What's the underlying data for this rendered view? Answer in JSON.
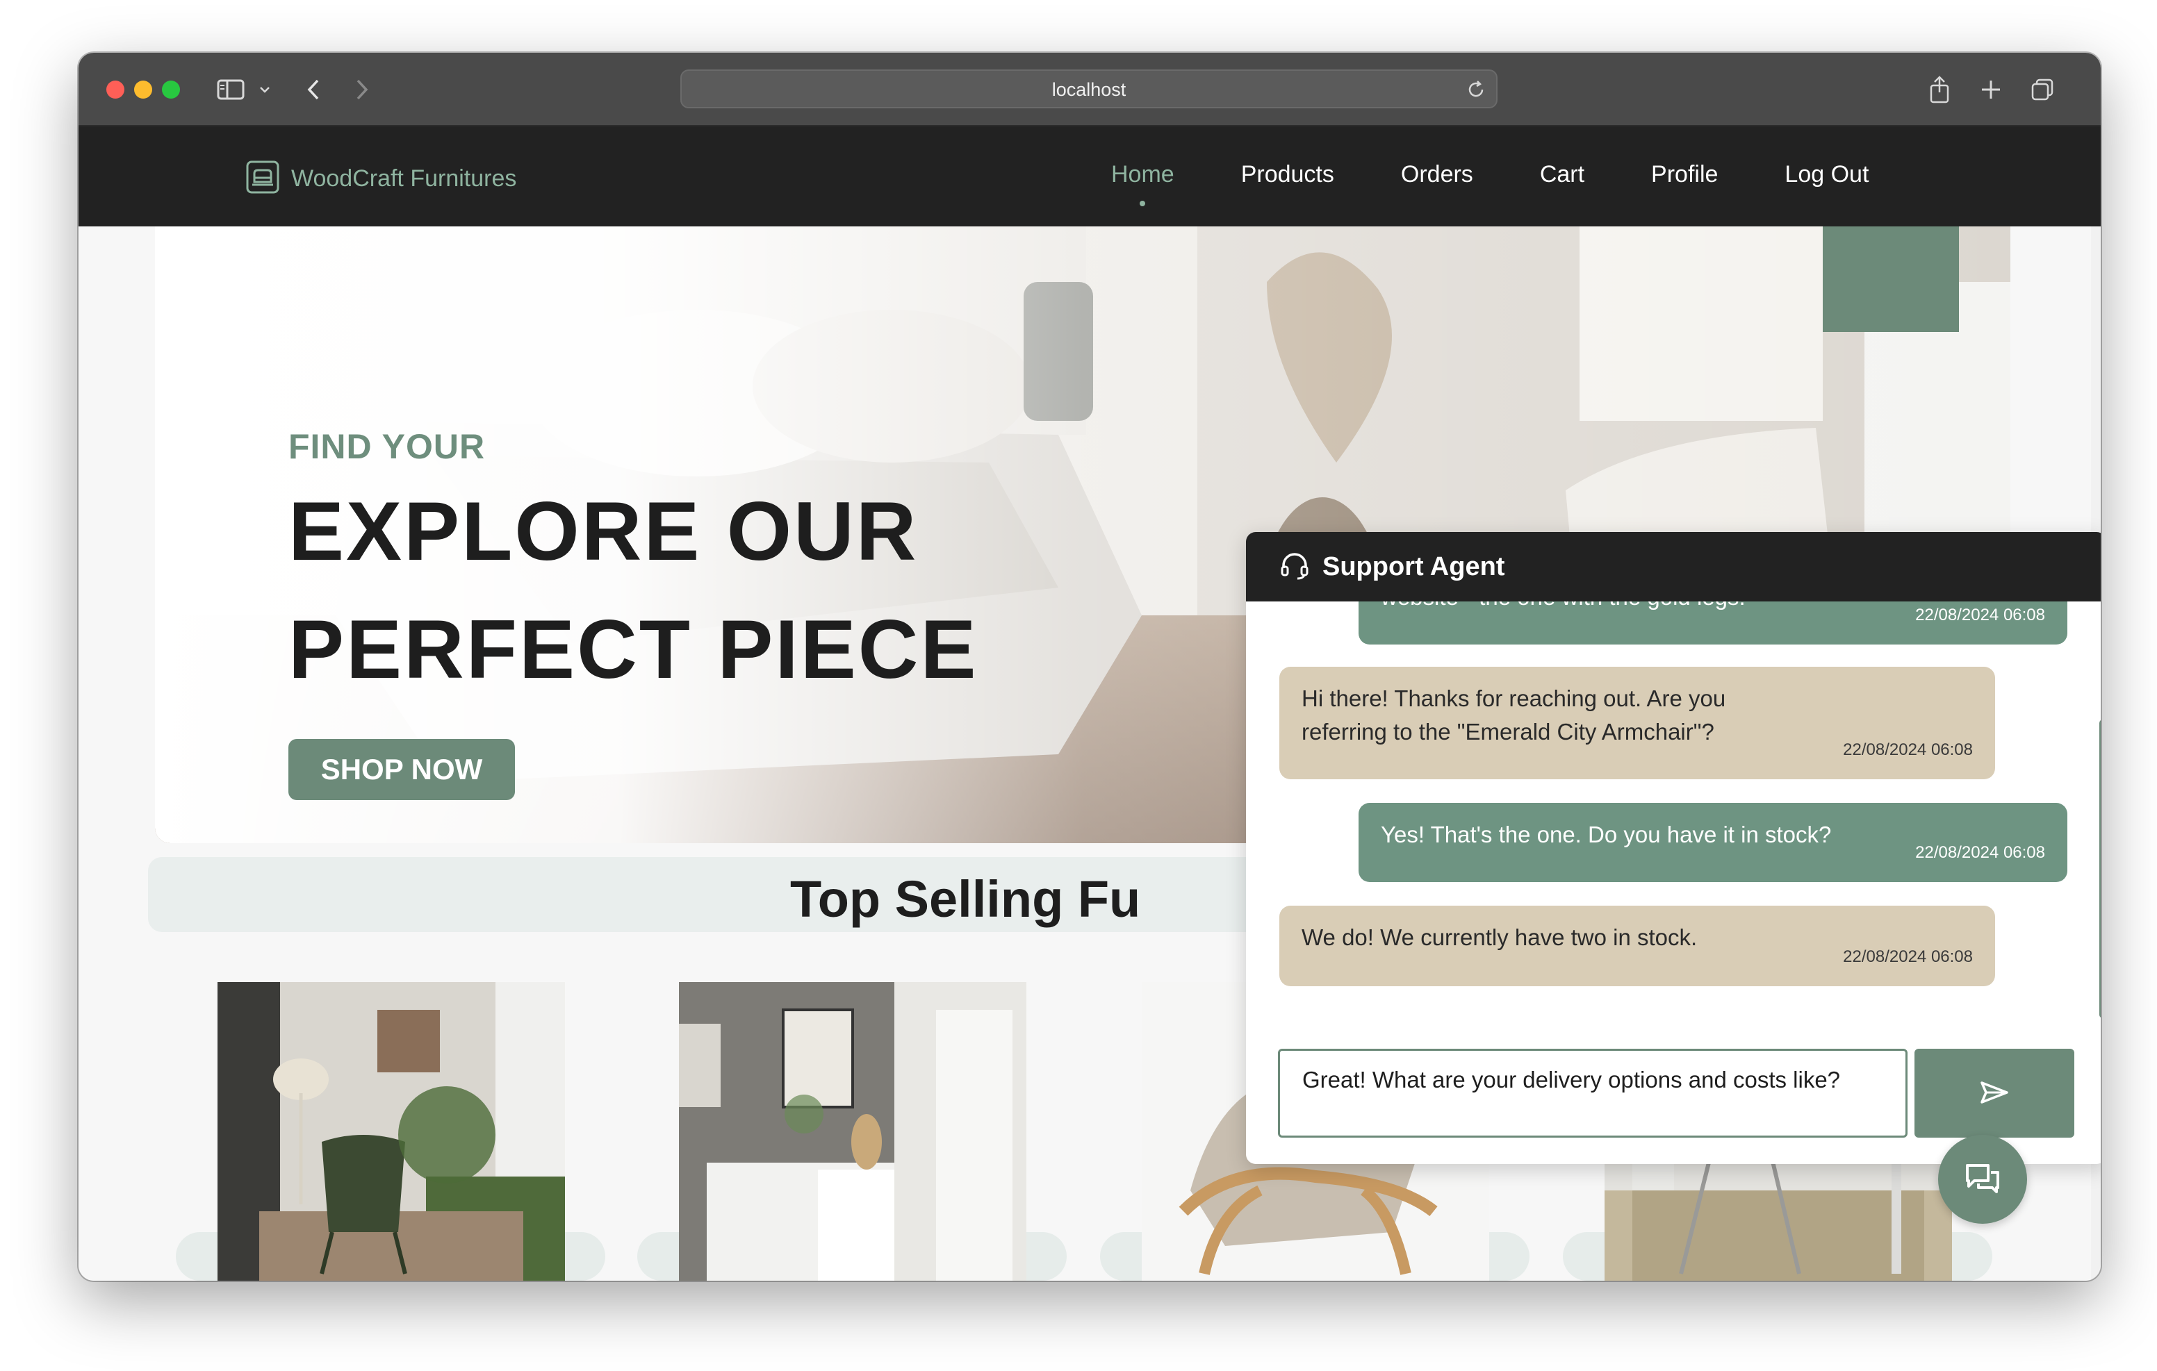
{
  "browser": {
    "url": "localhost"
  },
  "nav": {
    "brand": "WoodCraft Furnitures",
    "links": [
      "Home",
      "Products",
      "Orders",
      "Cart",
      "Profile",
      "Log Out"
    ],
    "active": "Home"
  },
  "hero": {
    "eyebrow": "FIND YOUR",
    "headline_line1": "EXPLORE OUR",
    "headline_line2": "PERFECT PIECE",
    "cta": "SHOP NOW"
  },
  "section": {
    "title": "Top Selling Fu"
  },
  "chat": {
    "title": "Support Agent",
    "messages": [
      {
        "role": "user",
        "text": "website - the one with the gold legs.",
        "time": "22/08/2024 06:08"
      },
      {
        "role": "agent",
        "text": "Hi there! Thanks for reaching out. Are you referring to the \"Emerald City Armchair\"?",
        "time": "22/08/2024 06:08"
      },
      {
        "role": "user",
        "text": "Yes! That's the one. Do you have it in stock?",
        "time": "22/08/2024 06:08"
      },
      {
        "role": "agent",
        "text": "We do! We currently have two in stock.",
        "time": "22/08/2024 06:08"
      }
    ],
    "input_value": "Great! What are your delivery options and costs like?"
  },
  "icons": {
    "brand": "armchair-icon",
    "chat_header": "headset-icon",
    "send": "send-icon",
    "fab": "chat-bubbles-icon"
  },
  "colors": {
    "accent": "#6c8a79",
    "user_bubble": "#6e9482",
    "agent_bubble": "#d9cdb6",
    "nav_bg": "#222222"
  }
}
